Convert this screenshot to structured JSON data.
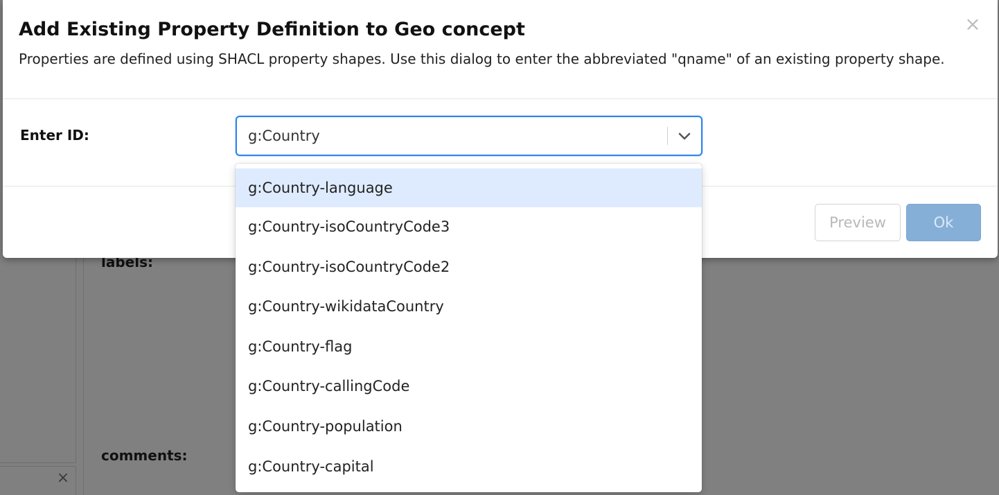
{
  "background": {
    "labels_heading": "labels:",
    "comments_heading": "comments:",
    "close_glyph": "×"
  },
  "modal": {
    "title": "Add Existing Property Definition to Geo concept",
    "subtitle": "Properties are defined using SHACL property shapes. Use this dialog to enter the abbreviated \"qname\" of an existing property shape.",
    "close_glyph": "×",
    "field_label": "Enter ID:",
    "select_value": "g:Country",
    "preview_label": "Preview",
    "ok_label": "Ok"
  },
  "dropdown": {
    "focused_index": 0,
    "options": [
      "g:Country-language",
      "g:Country-isoCountryCode3",
      "g:Country-isoCountryCode2",
      "g:Country-wikidataCountry",
      "g:Country-flag",
      "g:Country-callingCode",
      "g:Country-population",
      "g:Country-capital"
    ]
  },
  "colors": {
    "overlay": "#808080",
    "focus_border": "#2f84f0",
    "option_highlight": "#deebff",
    "ok_button": "#86afd7"
  },
  "icons": {
    "select_chevron": "chevron-down-icon",
    "modal_close": "close-icon"
  }
}
